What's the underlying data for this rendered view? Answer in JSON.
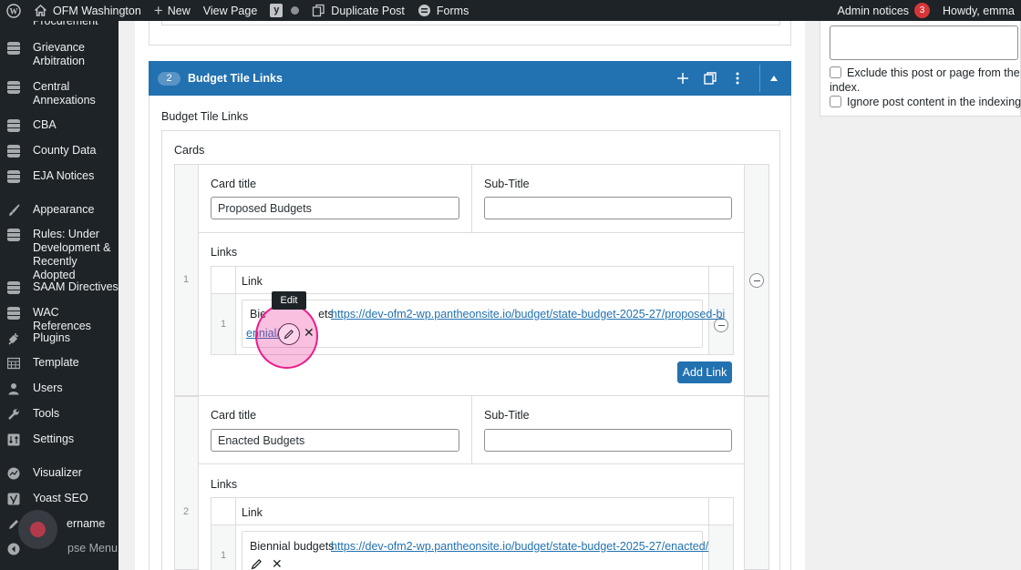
{
  "adminbar": {
    "site_name": "OFM Washington",
    "new_label": "New",
    "view_page": "View Page",
    "duplicate_post": "Duplicate Post",
    "forms": "Forms",
    "admin_notices": "Admin notices",
    "notices_count": "3",
    "howdy": "Howdy, emma"
  },
  "sidebar": {
    "items": [
      {
        "label": "Procurement"
      },
      {
        "label": "Grievance Arbitration"
      },
      {
        "label": "Central Annexations"
      },
      {
        "label": "CBA"
      },
      {
        "label": "County Data"
      },
      {
        "label": "EJA Notices"
      },
      {
        "label": "Appearance"
      },
      {
        "label": "Rules: Under Development & Recently Adopted"
      },
      {
        "label": "SAAM Directives"
      },
      {
        "label": "WAC References"
      },
      {
        "label": "Plugins"
      },
      {
        "label": "Template"
      },
      {
        "label": "Users"
      },
      {
        "label": "Tools"
      },
      {
        "label": "Settings"
      },
      {
        "label": "Visualizer"
      },
      {
        "label": "Yoast SEO"
      },
      {
        "label": "ername"
      },
      {
        "label": "pse Menu"
      }
    ]
  },
  "block": {
    "number": "2",
    "title": "Budget Tile Links",
    "field_label": "Budget Tile Links",
    "cards_label": "Cards"
  },
  "cards": [
    {
      "index": "1",
      "card_title_label": "Card title",
      "card_title_value": "Proposed Budgets",
      "subtitle_label": "Sub-Title",
      "subtitle_value": "",
      "links_label": "Links",
      "link_col_header": "Link",
      "link_row_index": "1",
      "link_text": "Bie",
      "link_text_tail": "ets",
      "link_url_line1": "https://dev-ofm2-wp.pantheonsite.io/budget/state-budget-2025-27/proposed-bi",
      "link_url_line2": "ennial/",
      "tooltip": "Edit",
      "add_link": "Add Link"
    },
    {
      "index": "2",
      "card_title_label": "Card title",
      "card_title_value": "Enacted Budgets",
      "subtitle_label": "Sub-Title",
      "subtitle_value": "",
      "links_label": "Links",
      "link_col_header": "Link",
      "link_row_index": "1",
      "link_text": "Biennial budgets",
      "link_url": "https://dev-ofm2-wp.pantheonsite.io/budget/state-budget-2025-27/enacted/"
    }
  ],
  "right_panel": {
    "exclude_label_line1": "Exclude this post or page from the",
    "exclude_label_line2": "index.",
    "ignore_label": "Ignore post content in the indexing."
  },
  "colors": {
    "admin_bar": "#1d2327",
    "accent": "#2271b1",
    "badge": "#d63638",
    "cursor_highlight": "#e91e8c"
  }
}
